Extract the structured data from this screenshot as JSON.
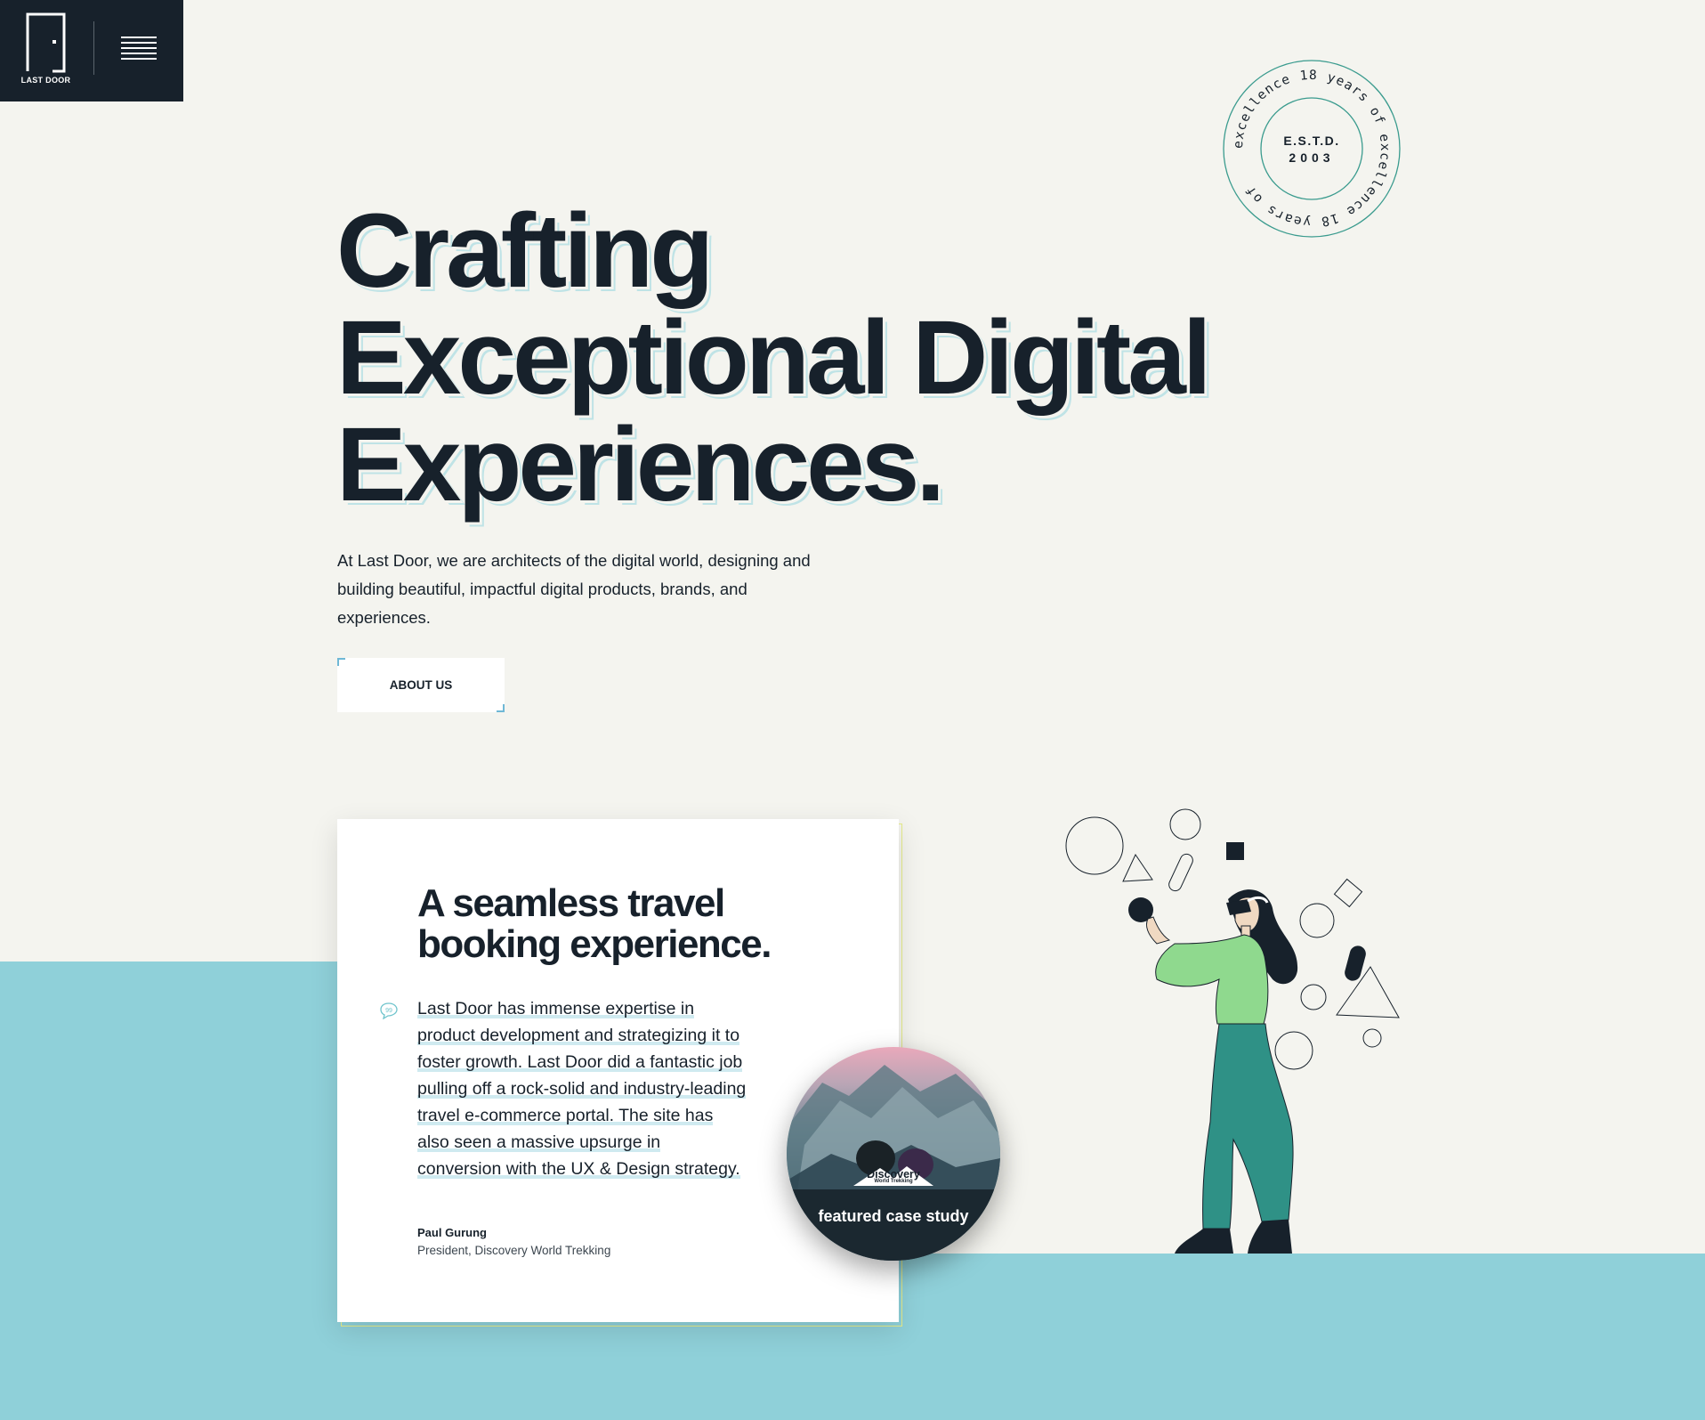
{
  "brand": {
    "logo_text": "LAST DOOR"
  },
  "stamp": {
    "ring_text": "excellence 18 years of excellence 18 years of",
    "line1": "E.S.T.D.",
    "line2": "2003"
  },
  "hero": {
    "title_lines": [
      "Crafting",
      "Exceptional Digital",
      "Experiences."
    ],
    "description": "At Last Door, we are architects of the digital world, designing and building beautiful, impactful digital products, brands, and experiences.",
    "cta_label": "ABOUT US"
  },
  "testimonial": {
    "title": "A seamless travel booking experience.",
    "quote": "Last Door has immense expertise in product development and strategizing it to foster growth. Last Door did a fantastic job pulling off a rock-solid and industry-leading travel e-commerce portal. The site has also seen a massive upsurge in conversion with the UX & Design strategy.",
    "author_name": "Paul Gurung",
    "author_role": "President, Discovery World Trekking"
  },
  "case_study": {
    "logo_name": "Discovery",
    "logo_sub": "World Trekking",
    "label": "featured case study"
  },
  "colors": {
    "dark": "#17212b",
    "background": "#f4f4ef",
    "teal_band": "#8fd0d9",
    "accent_green": "#3a9b8e",
    "shirt_green": "#8fd98e"
  }
}
